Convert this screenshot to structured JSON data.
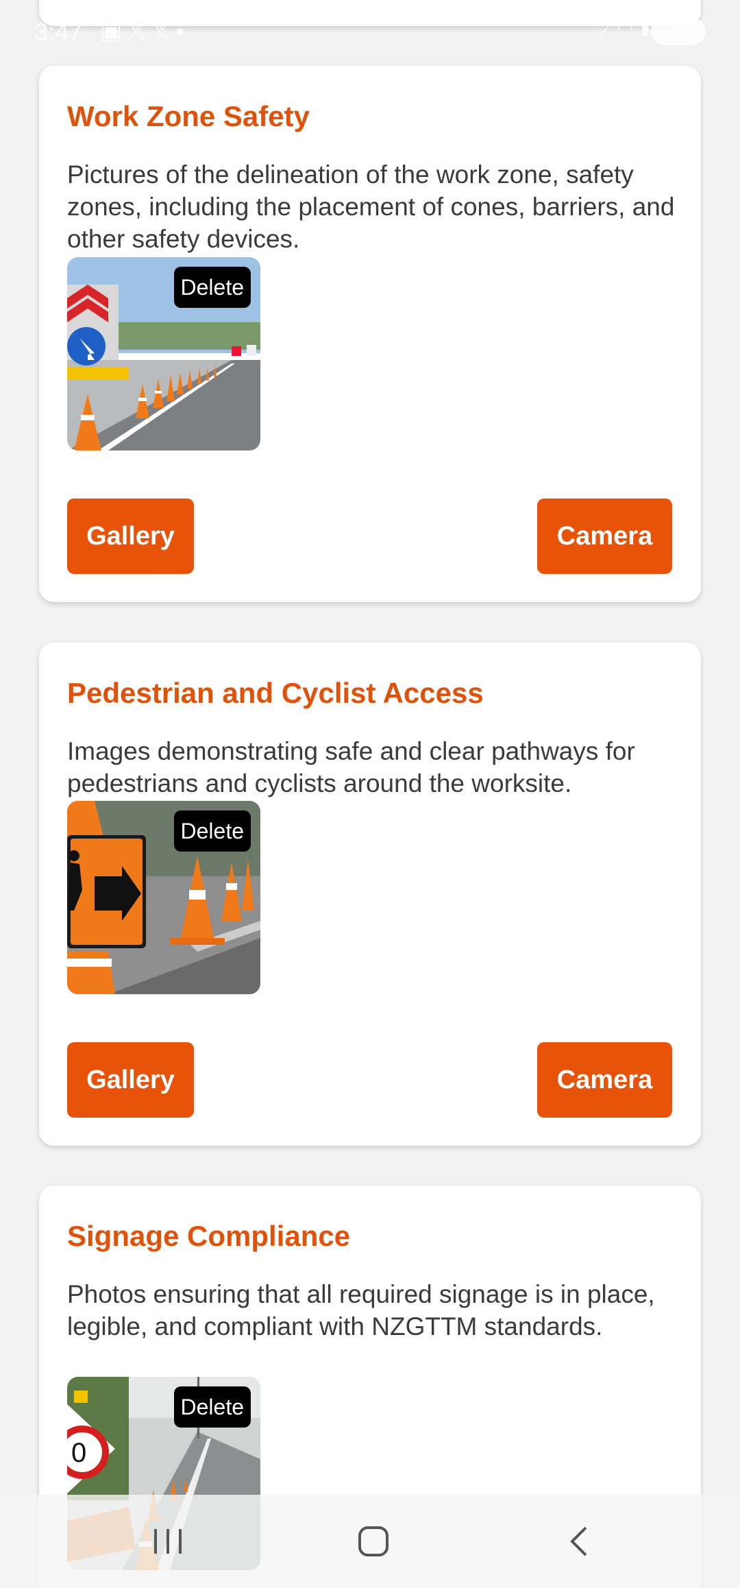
{
  "status_bar": {
    "time": "3:47",
    "left_icons": [
      "screenshot-icon",
      "x-icon",
      "x-icon",
      "dot-icon"
    ],
    "right_icons": [
      "mute-icon",
      "wifi-icon",
      "signal-icon"
    ],
    "battery": "24"
  },
  "cards": [
    {
      "title": "Work Zone Safety",
      "description": "Pictures of the delineation of the work zone, safety zones, including the placement of cones, barriers, and other safety devices.",
      "delete_label": "Delete",
      "gallery_label": "Gallery",
      "camera_label": "Camera"
    },
    {
      "title": "Pedestrian and Cyclist Access",
      "description": "Images demonstrating safe and clear pathways for pedestrians and cyclists around the worksite.",
      "delete_label": "Delete",
      "gallery_label": "Gallery",
      "camera_label": "Camera"
    },
    {
      "title": "Signage Compliance",
      "description": "Photos ensuring that all required signage is in place, legible, and compliant with NZGTTM standards.",
      "delete_label": "Delete"
    }
  ],
  "nav_bar": {
    "icons": [
      "recent-apps-icon",
      "home-icon",
      "back-icon"
    ]
  },
  "colors": {
    "accent": "#e8530a",
    "title": "#e0520a",
    "background": "#f2f2f2"
  }
}
